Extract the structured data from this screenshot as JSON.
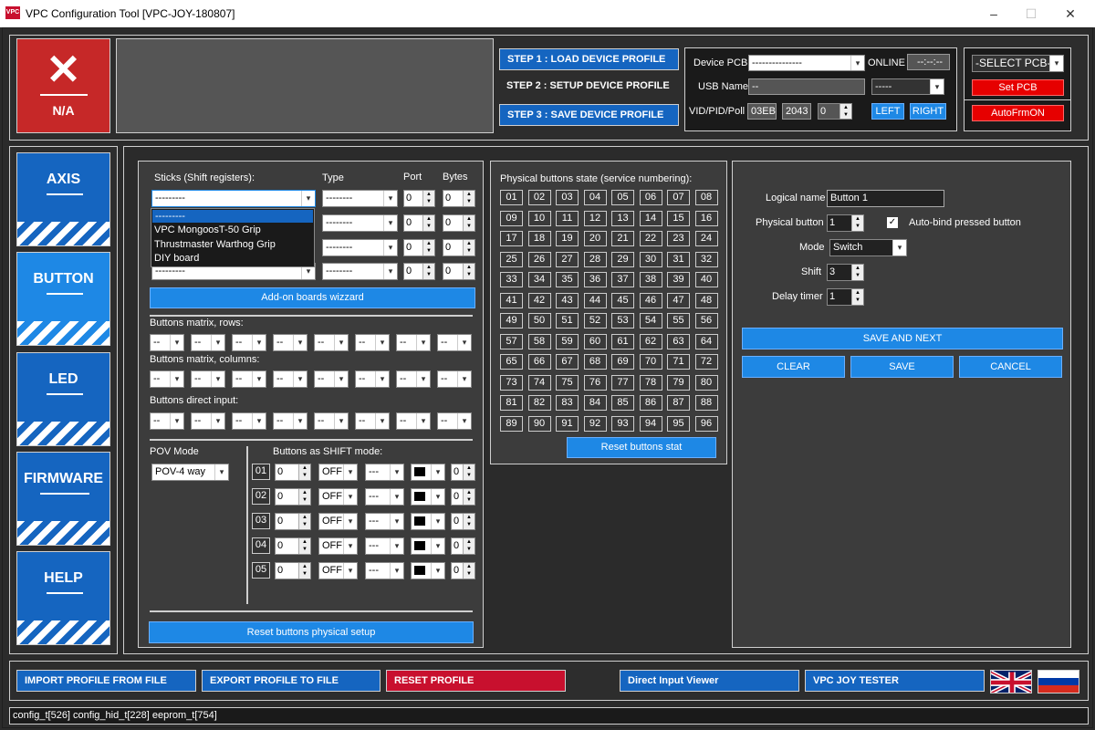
{
  "window": {
    "title": "VPC Configuration Tool [VPC-JOY-180807]",
    "logo": "VPC",
    "minimize": "–",
    "maximize": "☐",
    "close": "✕"
  },
  "header": {
    "status_label": "N/A",
    "steps": [
      "STEP 1 : LOAD DEVICE PROFILE",
      "STEP 2 : SETUP DEVICE PROFILE",
      "STEP 3 : SAVE DEVICE PROFILE"
    ],
    "device_pcb_label": "Device PCB",
    "device_pcb_value": "---------------",
    "online_label": "ONLINE",
    "online_value": "--:--:--",
    "usb_name_label": "USB Name",
    "usb_name_value": "--",
    "usb_select": "-----",
    "vid_label": "VID/PID/Poll",
    "vid": "03EB",
    "pid": "2043",
    "poll": "0",
    "left": "LEFT",
    "right": "RIGHT",
    "select_pcb": "-SELECT PCB-",
    "set_pcb": "Set PCB",
    "autofrm": "AutoFrmON"
  },
  "nav": [
    "AXIS",
    "BUTTON",
    "LED",
    "FIRMWARE",
    "HELP"
  ],
  "sticks": {
    "label": "Sticks (Shift registers):",
    "type_label": "Type",
    "port_label": "Port",
    "bytes_label": "Bytes",
    "rows": [
      {
        "stick": "---------",
        "type": "--------",
        "port": "0",
        "bytes": "0"
      },
      {
        "stick": "",
        "type": "--------",
        "port": "0",
        "bytes": "0"
      },
      {
        "stick": "",
        "type": "--------",
        "port": "0",
        "bytes": "0"
      },
      {
        "stick": "---------",
        "type": "--------",
        "port": "0",
        "bytes": "0"
      }
    ],
    "dropdown": [
      "---------",
      "VPC MongoosT-50 Grip",
      "Thrustmaster Warthog Grip",
      "DIY board"
    ],
    "addon": "Add-on boards wizzard",
    "matrix_rows_label": "Buttons matrix, rows:",
    "matrix_cols_label": "Buttons matrix, columns:",
    "direct_label": "Buttons direct input:",
    "dash": "--"
  },
  "pov": {
    "label": "POV Mode",
    "value": "POV-4 way",
    "shift_label": "Buttons as SHIFT mode:",
    "rows": [
      {
        "n": "01",
        "a": "0",
        "b": "OFF",
        "c": "---",
        "d": "0"
      },
      {
        "n": "02",
        "a": "0",
        "b": "OFF",
        "c": "---",
        "d": "0"
      },
      {
        "n": "03",
        "a": "0",
        "b": "OFF",
        "c": "---",
        "d": "0"
      },
      {
        "n": "04",
        "a": "0",
        "b": "OFF",
        "c": "---",
        "d": "0"
      },
      {
        "n": "05",
        "a": "0",
        "b": "OFF",
        "c": "---",
        "d": "0"
      }
    ],
    "reset": "Reset buttons physical setup"
  },
  "physical": {
    "label": "Physical buttons state (service numbering):",
    "reset": "Reset buttons stat",
    "buttons": [
      "01",
      "02",
      "03",
      "04",
      "05",
      "06",
      "07",
      "08",
      "09",
      "10",
      "11",
      "12",
      "13",
      "14",
      "15",
      "16",
      "17",
      "18",
      "19",
      "20",
      "21",
      "22",
      "23",
      "24",
      "25",
      "26",
      "27",
      "28",
      "29",
      "30",
      "31",
      "32",
      "33",
      "34",
      "35",
      "36",
      "37",
      "38",
      "39",
      "40",
      "41",
      "42",
      "43",
      "44",
      "45",
      "46",
      "47",
      "48",
      "49",
      "50",
      "51",
      "52",
      "53",
      "54",
      "55",
      "56",
      "57",
      "58",
      "59",
      "60",
      "61",
      "62",
      "63",
      "64",
      "65",
      "66",
      "67",
      "68",
      "69",
      "70",
      "71",
      "72",
      "73",
      "74",
      "75",
      "76",
      "77",
      "78",
      "79",
      "80",
      "81",
      "82",
      "83",
      "84",
      "85",
      "86",
      "87",
      "88",
      "89",
      "90",
      "91",
      "92",
      "93",
      "94",
      "95",
      "96"
    ]
  },
  "logical": {
    "name_label": "Logical name",
    "name_value": "Button 1",
    "phys_label": "Physical button",
    "phys_value": "1",
    "autobind": "Auto-bind pressed button",
    "mode_label": "Mode",
    "mode_value": "Switch",
    "shift_label": "Shift",
    "shift_value": "3",
    "delay_label": "Delay timer",
    "delay_value": "1",
    "save_next": "SAVE AND NEXT",
    "clear": "CLEAR",
    "save": "SAVE",
    "cancel": "CANCEL"
  },
  "footer": {
    "import": "IMPORT PROFILE FROM FILE",
    "export": "EXPORT PROFILE TO FILE",
    "reset": "RESET PROFILE",
    "direct": "Direct Input Viewer",
    "tester": "VPC JOY TESTER"
  },
  "statusbar": "config_t[526] config_hid_t[228] eeprom_t[754]"
}
